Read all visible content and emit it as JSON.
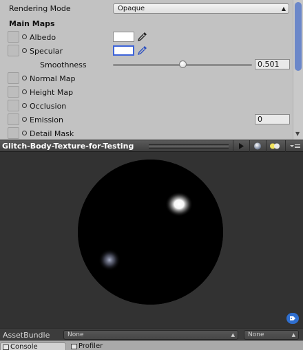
{
  "inspector": {
    "rendering_mode_label": "Rendering Mode",
    "rendering_mode_value": "Opaque",
    "main_maps_header": "Main Maps",
    "albedo_label": "Albedo",
    "specular_label": "Specular",
    "smoothness_label": "Smoothness",
    "smoothness_value": "0.501",
    "smoothness_fraction": 0.501,
    "normal_map_label": "Normal Map",
    "height_map_label": "Height Map",
    "occlusion_label": "Occlusion",
    "emission_label": "Emission",
    "emission_value": "0",
    "detail_mask_label": "Detail Mask"
  },
  "preview": {
    "title": "Glitch-Body-Texture-for-Testing"
  },
  "asset_bundle": {
    "label": "AssetBundle",
    "bundle_value": "None",
    "variant_value": "None"
  },
  "bottom_tabs": {
    "console": "Console",
    "profiler": "Profiler"
  },
  "colors": {
    "inspector_bg": "#c2c2c2",
    "preview_bg": "#323232",
    "selection_blue": "#3d63d8"
  },
  "icons": [
    "eyedropper-icon",
    "play-icon",
    "sphere-icon",
    "light-icon",
    "menu-icon",
    "tag-icon",
    "chevron-updown-icon"
  ]
}
